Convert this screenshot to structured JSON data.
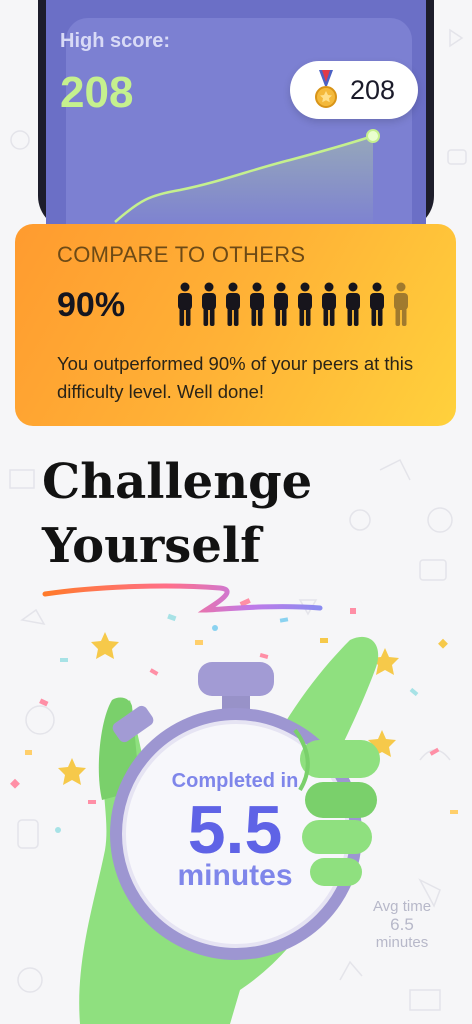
{
  "phone": {
    "high_score_label": "High score:",
    "high_score_value": "208",
    "medal_icon": "medal-icon",
    "medal_value": "208"
  },
  "compare": {
    "title": "COMPARE TO OTHERS",
    "percent": "90%",
    "people_filled": 9,
    "people_total": 10,
    "message": "You outperformed 90% of your peers at this difficulty level. Well done!"
  },
  "headline": {
    "line1": "Challenge",
    "line2": "Yourself"
  },
  "stopwatch": {
    "completed_label": "Completed in",
    "time_value": "5.5",
    "time_unit": "minutes"
  },
  "average": {
    "label": "Avg time",
    "value": "6.5",
    "unit": "minutes"
  },
  "colors": {
    "accent_green": "#c5f08e",
    "card_orange": "#ffb236",
    "dial_blue": "#5f63e6"
  }
}
